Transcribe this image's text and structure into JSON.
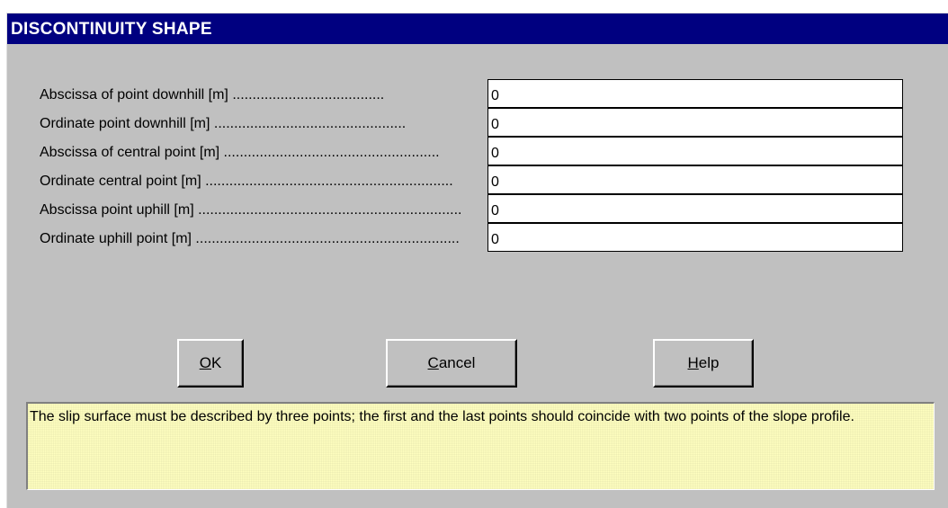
{
  "window": {
    "title": "DISCONTINUITY SHAPE"
  },
  "fields": [
    {
      "label": "Abscissa of point downhill [m] ......................................",
      "value": "0"
    },
    {
      "label": "Ordinate point downhill [m] ................................................",
      "value": "0"
    },
    {
      "label": "Abscissa of central point [m] ......................................................",
      "value": "0"
    },
    {
      "label": "Ordinate central point [m] ..............................................................",
      "value": "0"
    },
    {
      "label": "Abscissa point uphill [m] ..................................................................",
      "value": "0"
    },
    {
      "label": "Ordinate uphill point [m] ..................................................................",
      "value": "0"
    }
  ],
  "buttons": {
    "ok_mnemonic": "O",
    "ok_rest": "K",
    "cancel_mnemonic": "C",
    "cancel_rest": "ancel",
    "help_mnemonic": "H",
    "help_rest": "elp"
  },
  "message": "The slip surface must be described by three points; the first and the last points should coincide with two points of  the slope profile.",
  "colors": {
    "titlebar": "#000080",
    "dialog_background": "#c0c0c0",
    "message_background": "#ffffc0"
  }
}
